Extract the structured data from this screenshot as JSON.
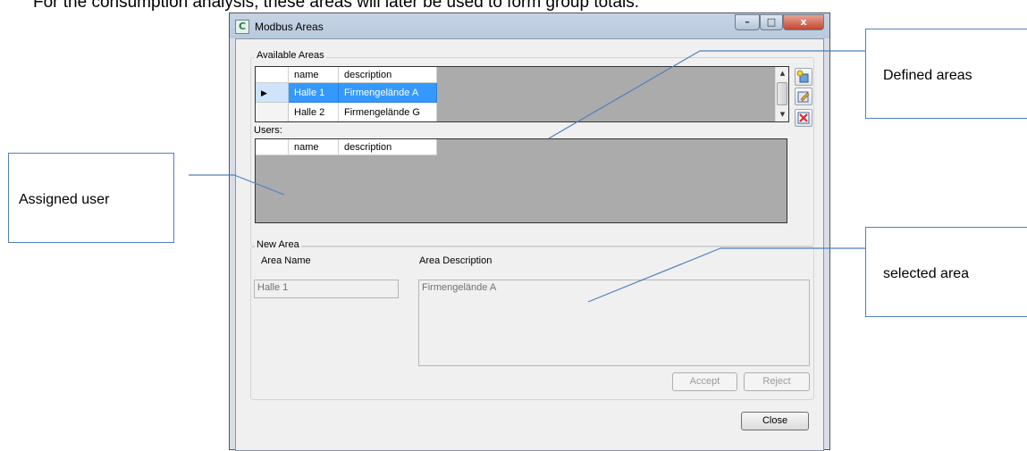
{
  "document": {
    "intro_text": "For the consumption analysis, these areas will later be used to form group totals."
  },
  "window": {
    "title": "Modbus Areas",
    "buttons": {
      "minimize": "–",
      "maximize": "□",
      "close": "x"
    }
  },
  "available_areas": {
    "label": "Available Areas",
    "columns": [
      "name",
      "description"
    ],
    "rows": [
      {
        "name": "Halle 1",
        "description": "Firmengelände A",
        "selected": true
      },
      {
        "name": "Halle 2",
        "description": "Firmengelände G",
        "selected": false
      }
    ],
    "row_pointer": "▶"
  },
  "users": {
    "label": "Users:",
    "columns": [
      "name",
      "description"
    ]
  },
  "new_area": {
    "label": "New Area",
    "area_name_label": "Area Name",
    "area_description_label": "Area Description",
    "area_name_value": "Halle 1",
    "area_description_value": "Firmengelände A",
    "accept_label": "Accept",
    "reject_label": "Reject"
  },
  "close_label": "Close",
  "callouts": {
    "defined_areas": "Defined areas",
    "assigned_user": "Assigned user",
    "selected_area": "selected area"
  },
  "colors": {
    "selection": "#3399ff",
    "grid_background": "#ababab",
    "callout_border": "#4f81bd"
  }
}
